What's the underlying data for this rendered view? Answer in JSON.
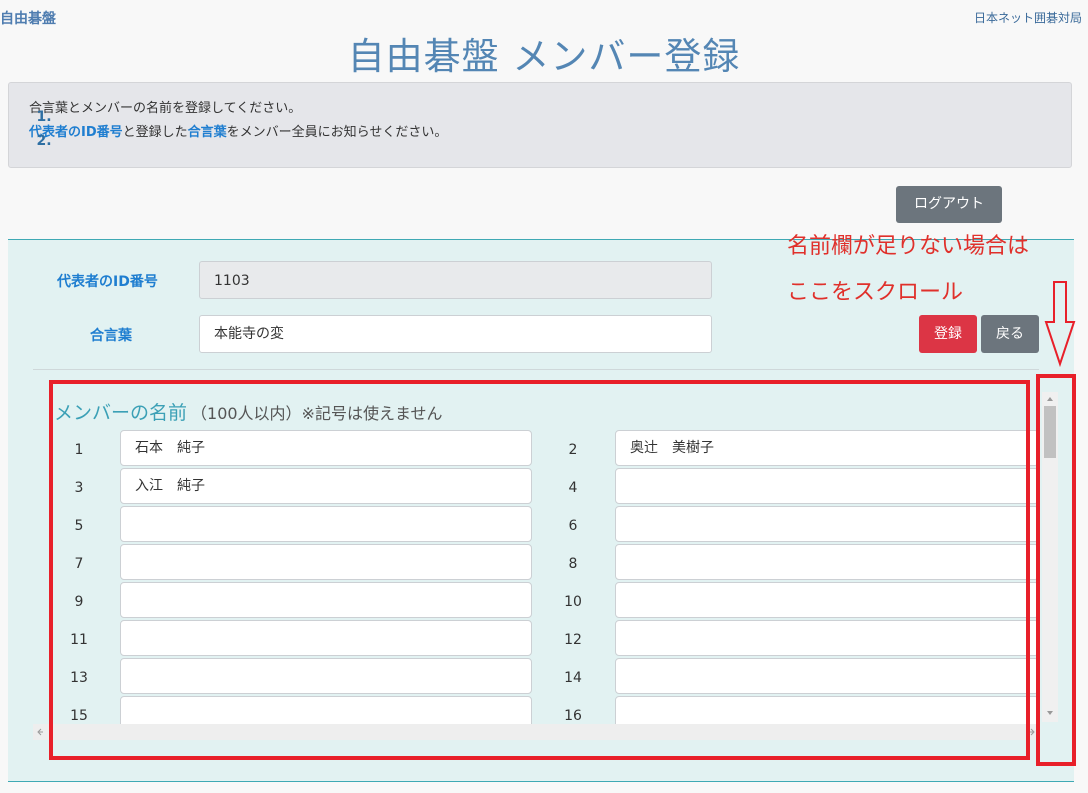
{
  "header": {
    "brand": "自由碁盤",
    "org_link": "日本ネット囲碁対局",
    "title": "自由碁盤 メンバー登録"
  },
  "instructions": {
    "line1_num": "1.",
    "line1_text": "合言葉とメンバーの名前を登録してください。",
    "line2_num": "2.",
    "line2_part1": "代表者のID番号",
    "line2_part2": "と登録した",
    "line2_part3": "合言葉",
    "line2_part4": "をメンバー全員にお知らせください。"
  },
  "buttons": {
    "logout": "ログアウト",
    "register": "登録",
    "back": "戻る"
  },
  "form": {
    "id_label": "代表者のID番号",
    "id_value": "1103",
    "password_label": "合言葉",
    "password_value": "本能寺の変"
  },
  "members": {
    "title": "メンバーの名前",
    "subtitle": "（100人以内）※記号は使えません",
    "rows": [
      {
        "left_num": "1",
        "left_value": "石本　純子",
        "right_num": "2",
        "right_value": "奥辻　美樹子"
      },
      {
        "left_num": "3",
        "left_value": "入江　純子",
        "right_num": "4",
        "right_value": ""
      },
      {
        "left_num": "5",
        "left_value": "",
        "right_num": "6",
        "right_value": ""
      },
      {
        "left_num": "7",
        "left_value": "",
        "right_num": "8",
        "right_value": ""
      },
      {
        "left_num": "9",
        "left_value": "",
        "right_num": "10",
        "right_value": ""
      },
      {
        "left_num": "11",
        "left_value": "",
        "right_num": "12",
        "right_value": ""
      },
      {
        "left_num": "13",
        "left_value": "",
        "right_num": "14",
        "right_value": ""
      },
      {
        "left_num": "15",
        "left_value": "",
        "right_num": "16",
        "right_value": ""
      }
    ]
  },
  "annotation": {
    "line1": "名前欄が足りない場合は",
    "line2": "ここをスクロール"
  },
  "colors": {
    "accent": "#1f7ed0",
    "title": "#5486b4",
    "register": "#dc3545",
    "secondary": "#6c757d",
    "annotation": "#e8202a"
  },
  "icons": [
    "arrow-down-icon",
    "scroll-up-arrow-icon",
    "scroll-down-arrow-icon",
    "scroll-left-arrow-icon",
    "scroll-right-arrow-icon"
  ]
}
